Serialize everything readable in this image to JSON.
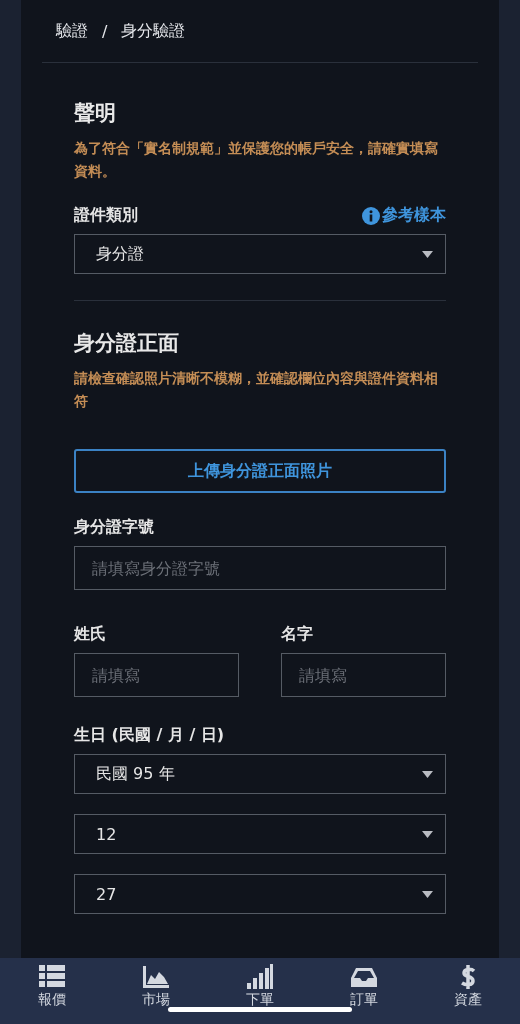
{
  "breadcrumb": {
    "parent": "驗證",
    "separator": "/",
    "current": "身分驗證"
  },
  "statement": {
    "title": "聲明",
    "notice": "為了符合「實名制規範」並保護您的帳戶安全，請確實填寫資料。"
  },
  "document_type": {
    "label": "證件類別",
    "sample_link": "參考樣本",
    "value": "身分證"
  },
  "id_front": {
    "title": "身分證正面",
    "notice": "請檢查確認照片清晰不模糊，並確認欄位內容與證件資料相符",
    "upload_button": "上傳身分證正面照片"
  },
  "id_number": {
    "label": "身分證字號",
    "placeholder": "請填寫身分證字號"
  },
  "surname": {
    "label": "姓氏",
    "placeholder": "請填寫"
  },
  "given_name": {
    "label": "名字",
    "placeholder": "請填寫"
  },
  "birthday": {
    "label": "生日 (民國 / 月 / 日)",
    "selects": [
      "民國 95 年",
      "12",
      "27"
    ]
  },
  "tab_bar": [
    {
      "label": "報價",
      "kind": "list"
    },
    {
      "label": "市場",
      "kind": "chart"
    },
    {
      "label": "下單",
      "kind": "bars"
    },
    {
      "label": "訂單",
      "kind": "tray"
    },
    {
      "label": "資產",
      "kind": "dollar"
    }
  ]
}
